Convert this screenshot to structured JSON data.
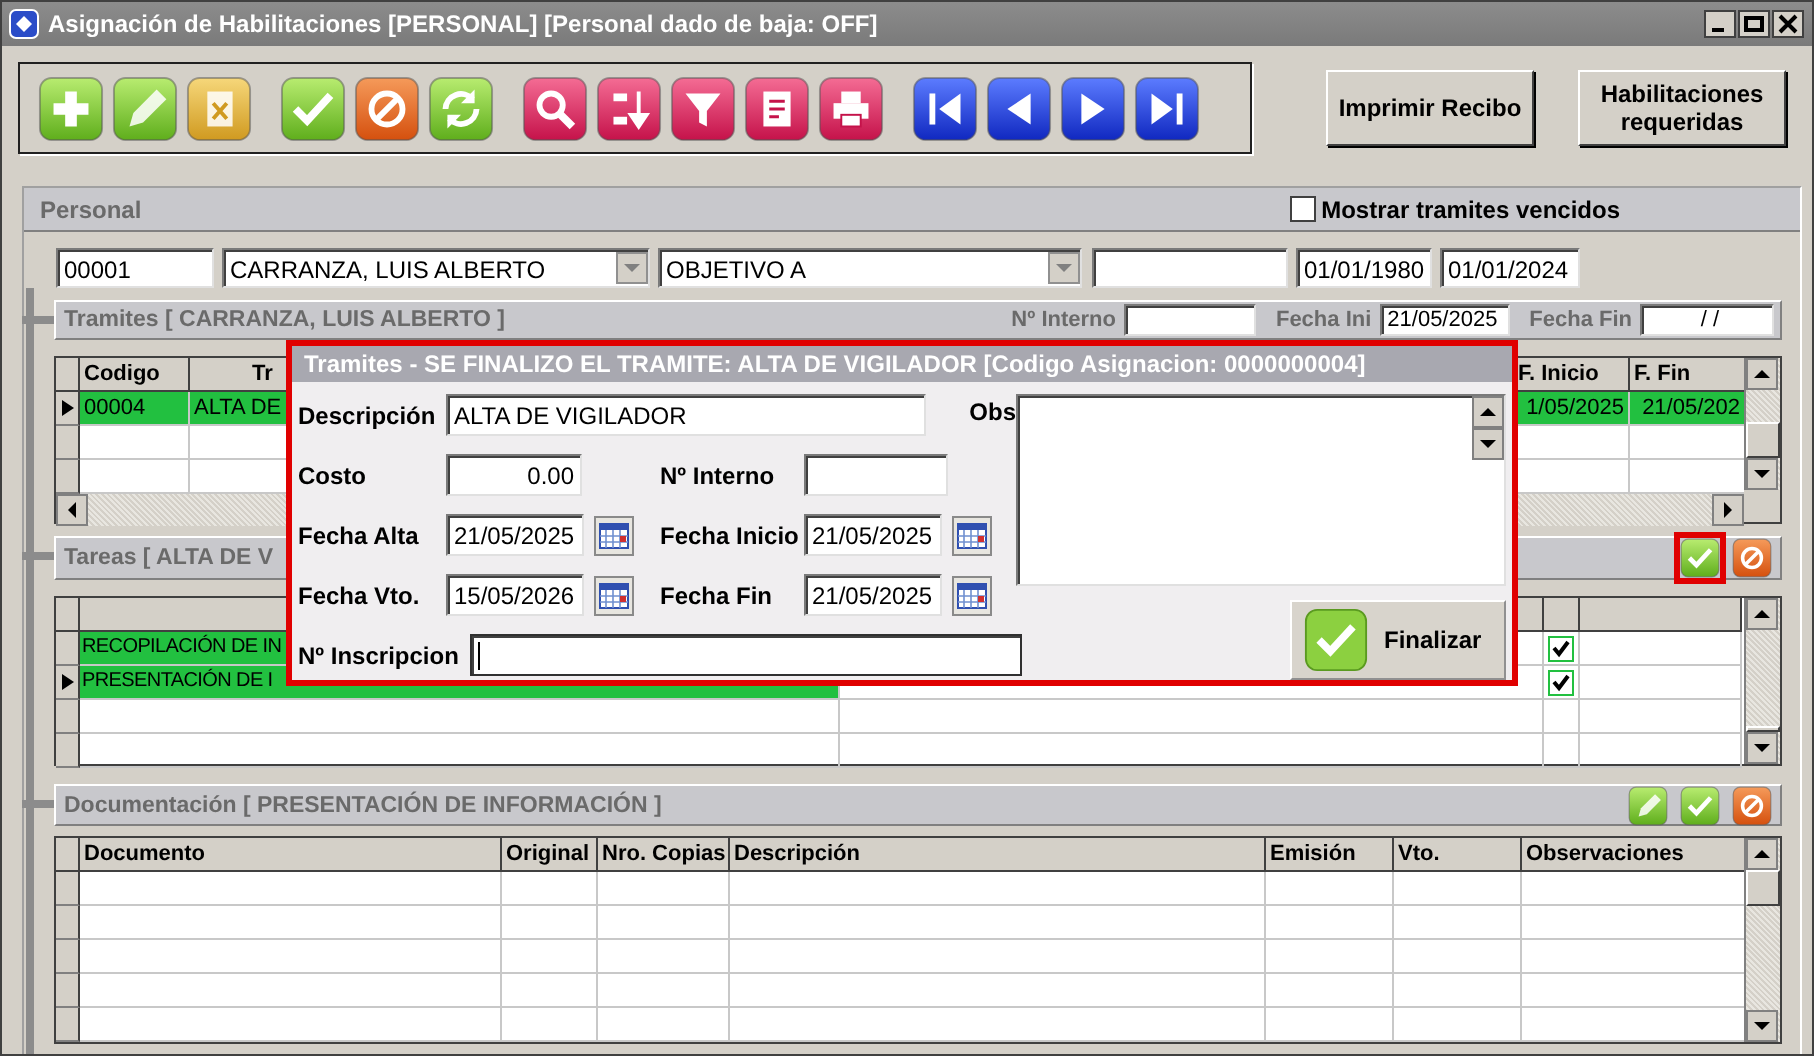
{
  "window": {
    "title": "Asignación de Habilitaciones [PERSONAL] [Personal dado de baja: OFF]"
  },
  "toolbar": {
    "groups": [
      [
        {
          "kind": "add"
        },
        {
          "kind": "edit"
        },
        {
          "kind": "delete"
        }
      ],
      [
        {
          "kind": "accept"
        },
        {
          "kind": "cancel"
        },
        {
          "kind": "refresh"
        }
      ],
      [
        {
          "kind": "search"
        },
        {
          "kind": "sort"
        },
        {
          "kind": "filter"
        },
        {
          "kind": "report"
        },
        {
          "kind": "print"
        }
      ],
      [
        {
          "kind": "first"
        },
        {
          "kind": "prev"
        },
        {
          "kind": "next"
        },
        {
          "kind": "last"
        }
      ]
    ]
  },
  "buttons": [
    "Imprimir Recibo",
    "Habilitaciones requeridas"
  ],
  "personal": {
    "title": "Personal",
    "show_expired": {
      "label": "Mostrar tramites vencidos",
      "checked": false
    },
    "fields": [
      {
        "kind": "text",
        "value": "00001"
      },
      {
        "kind": "combo",
        "value": "CARRANZA, LUIS ALBERTO"
      },
      {
        "kind": "combo",
        "value": "OBJETIVO A"
      },
      {
        "kind": "text"
      },
      {
        "kind": "text",
        "value": "01/01/1980"
      },
      {
        "kind": "text",
        "value": "01/01/2024"
      }
    ]
  },
  "tramites": {
    "title": "Tramites [ CARRANZA, LUIS ALBERTO ]",
    "filters": [
      {
        "label": "Nº Interno"
      },
      {
        "label": "Fecha Ini",
        "value": "21/05/2025"
      },
      {
        "label": "Fecha Fin",
        "value": " / /"
      }
    ],
    "columns": [
      "Codigo",
      "Tr",
      "F. Inicio",
      "F. Fin"
    ],
    "rows": [
      {
        "cells": [
          "00004",
          "ALTA DE",
          "1/05/2025",
          "21/05/202"
        ],
        "selected": true,
        "completed": true
      }
    ]
  },
  "tareas": {
    "title": "Tareas [ ALTA DE V",
    "actions": [
      {
        "kind": "accept",
        "focused": true
      },
      {
        "kind": "cancel",
        "focused": false
      }
    ],
    "rows": [
      {
        "cells": [
          "RECOPILACIÓN DE IN"
        ],
        "selected": false,
        "completed": true,
        "checked": true
      },
      {
        "cells": [
          "PRESENTACIÓN DE I"
        ],
        "selected": true,
        "completed": true,
        "checked": true
      }
    ]
  },
  "documentacion": {
    "title": "Documentación [ PRESENTACIÓN DE INFORMACIÓN ]",
    "actions": [
      {
        "kind": "edit",
        "focused": false
      },
      {
        "kind": "accept",
        "focused": false
      },
      {
        "kind": "cancel",
        "focused": false
      }
    ],
    "columns": [
      "Documento",
      "Original",
      "Nro. Copias",
      "Descripción",
      "Emisión",
      "Vto.",
      "Observaciones"
    ]
  },
  "dialog": {
    "title": "Tramites - SE FINALIZO EL TRAMITE: ALTA DE VIGILADOR [Codigo Asignacion: 0000000004]",
    "fields": [
      {
        "kind": "text",
        "label": "Descripción",
        "value": "ALTA DE VIGILADOR",
        "focused": false
      },
      {
        "kind": "memo",
        "label": "Obs",
        "focused": false
      },
      {
        "kind": "number",
        "label": "Costo",
        "value": "0.00",
        "focused": false
      },
      {
        "kind": "text",
        "label": "Nº Interno",
        "focused": false
      },
      {
        "kind": "date",
        "label": "Fecha Alta",
        "value": "21/05/2025",
        "focused": false
      },
      {
        "kind": "date",
        "label": "Fecha Inicio",
        "value": "21/05/2025",
        "focused": false
      },
      {
        "kind": "date",
        "label": "Fecha Vto.",
        "value": "15/05/2026",
        "focused": false
      },
      {
        "kind": "date",
        "label": "Fecha Fin",
        "value": "21/05/2025",
        "focused": false
      },
      {
        "kind": "text",
        "label": "Nº Inscripcion",
        "focused": true
      }
    ],
    "button": "Finalizar"
  }
}
